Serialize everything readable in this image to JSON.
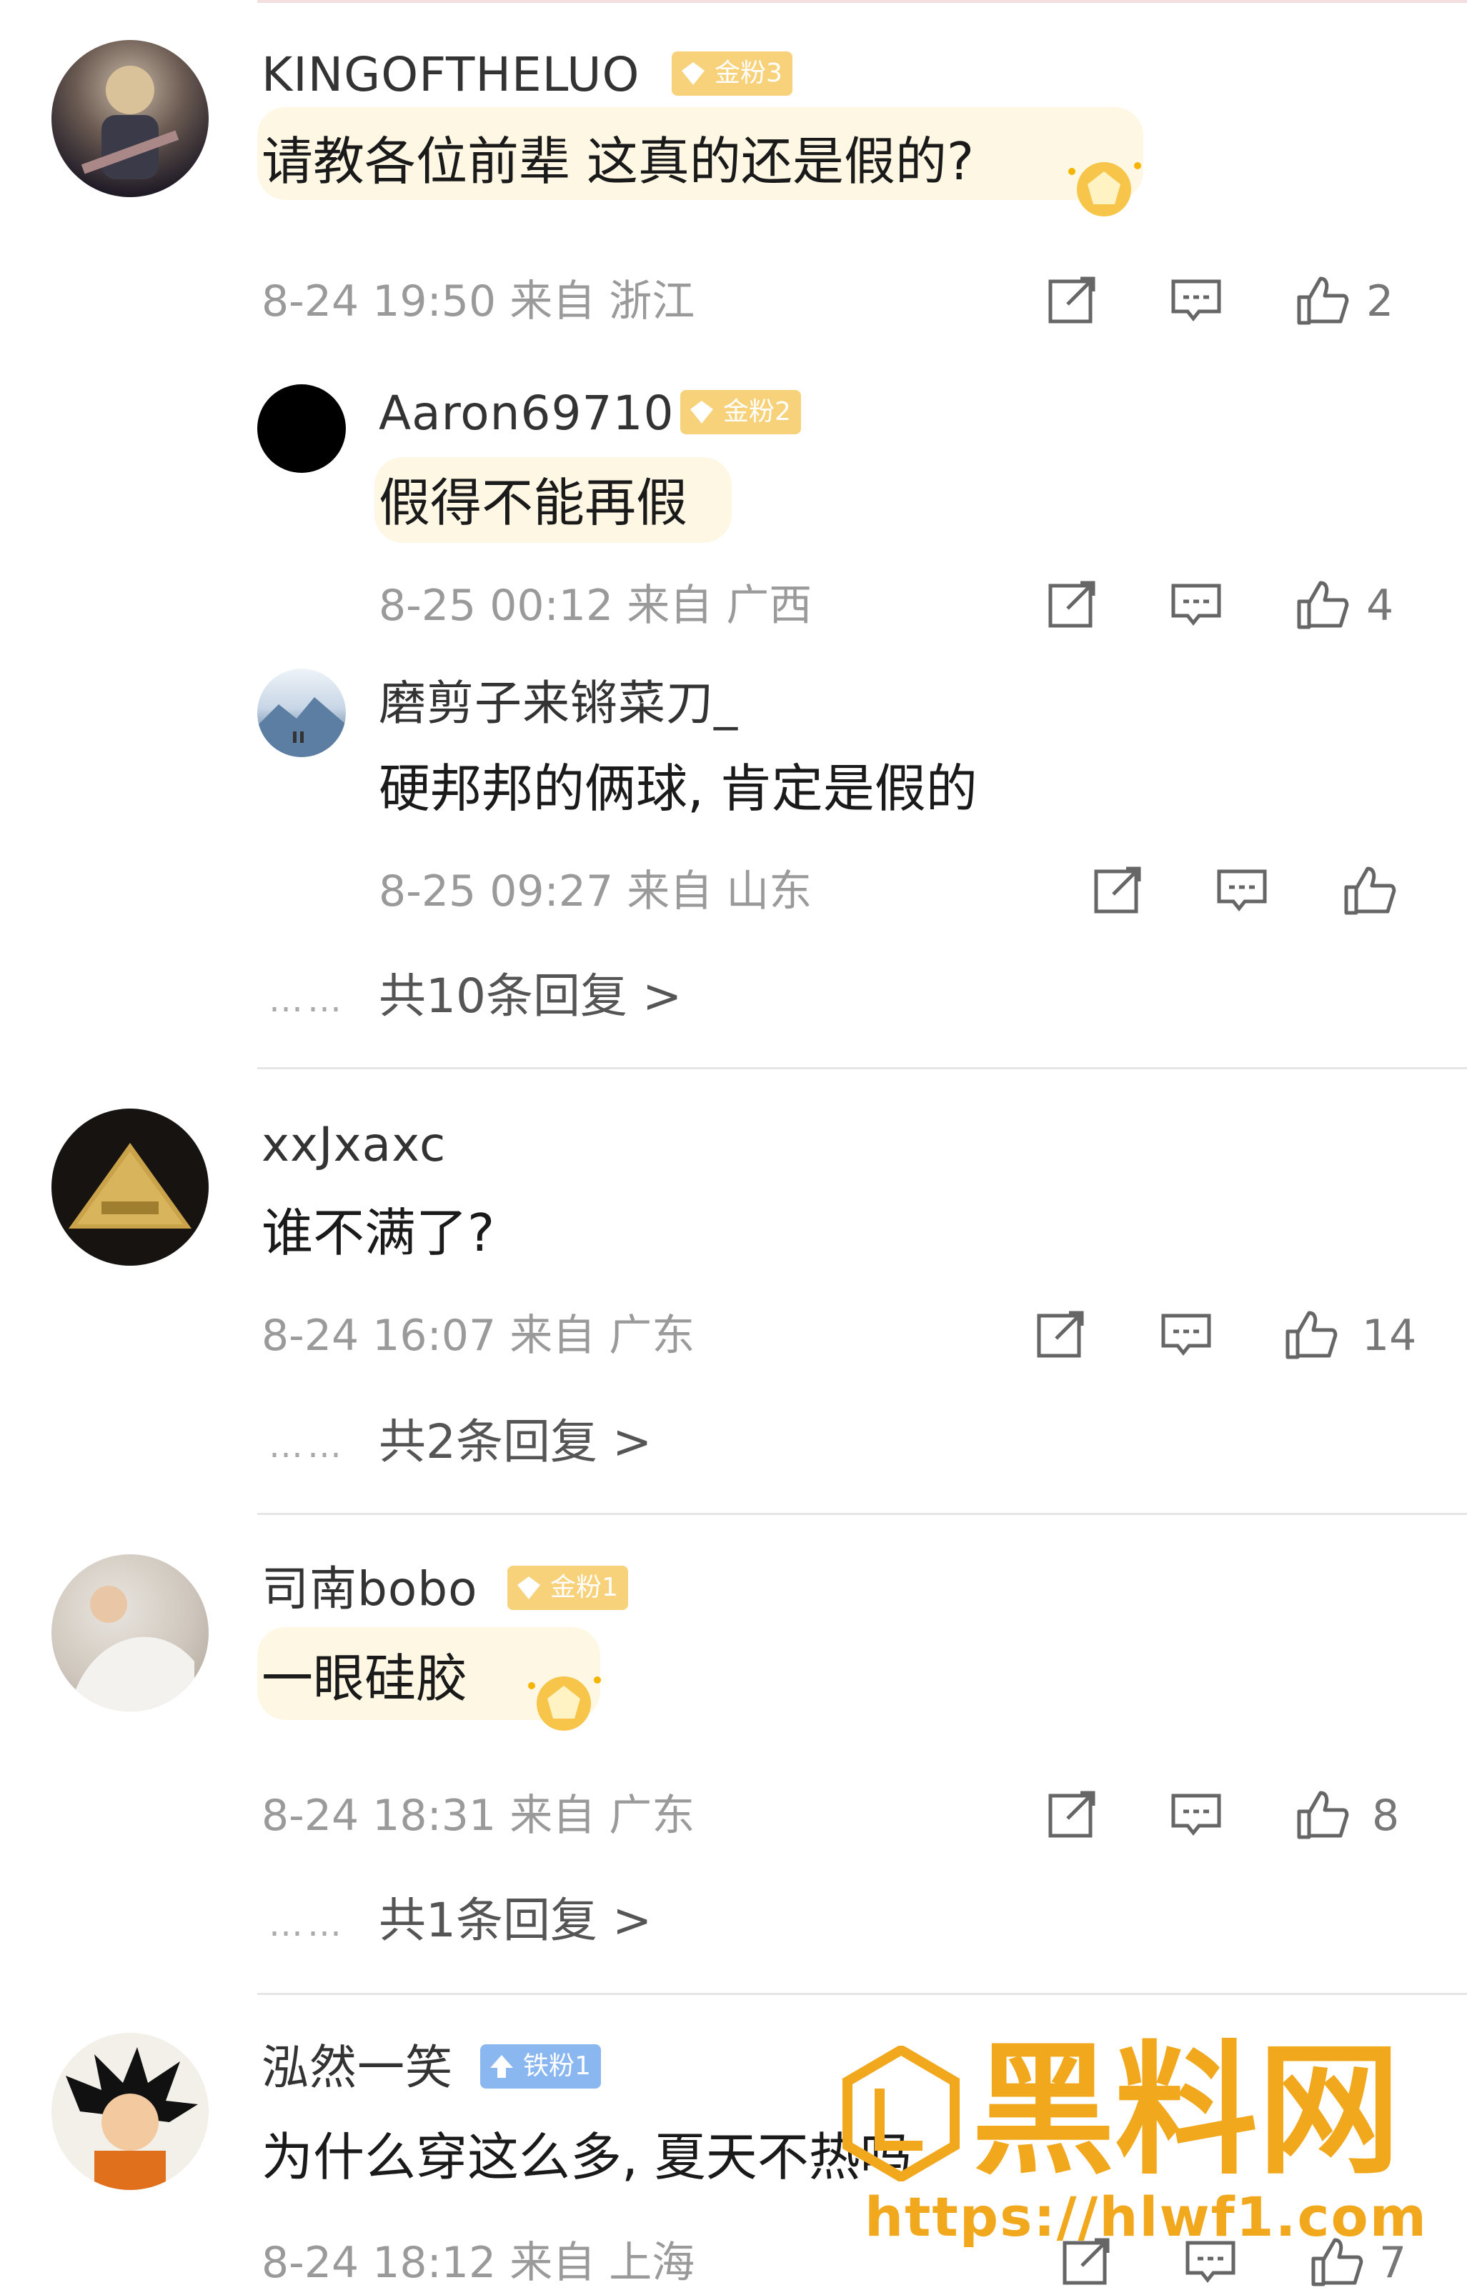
{
  "comments": [
    {
      "user": "KINGOFTHELUO",
      "badge": "金粉3",
      "text": "请教各位前辈 这真的还是假的?",
      "time": "8-24 19:50 来自 浙江",
      "likes": "2",
      "replies": [
        {
          "user": "Aaron69710",
          "badge": "金粉2",
          "text": "假得不能再假",
          "time": "8-25 00:12 来自 广西",
          "likes": "4"
        },
        {
          "user": "磨剪子来锵菜刀_",
          "text": "硬邦邦的俩球, 肯定是假的",
          "time": "8-25 09:27 来自 山东",
          "likes": ""
        }
      ],
      "reply_count": "共10条回复 >"
    },
    {
      "user": "xxJxaxc",
      "text": "谁不满了?",
      "time": "8-24 16:07 来自 广东",
      "likes": "14",
      "reply_count": "共2条回复 >"
    },
    {
      "user": "司南bobo",
      "badge": "金粉1",
      "text": "一眼硅胶",
      "time": "8-24 18:31 来自 广东",
      "likes": "8",
      "reply_count": "共1条回复 >"
    },
    {
      "user": "泓然一笑",
      "badge": "铁粉1",
      "text": "为什么穿这么多, 夏天不热吗",
      "time": "8-24 18:12 来自 上海",
      "likes": "7"
    }
  ],
  "dots": "……",
  "watermark": {
    "brand": "黑料网",
    "url": "https://hlwf1.com"
  },
  "colors": {
    "badge_gold": "#f7d27a",
    "badge_blue": "#8ab7ef",
    "watermark": "#f2a81d"
  },
  "icons": [
    "share-icon",
    "comment-icon",
    "like-icon",
    "badge-diamond-icon",
    "sticker-icon"
  ]
}
